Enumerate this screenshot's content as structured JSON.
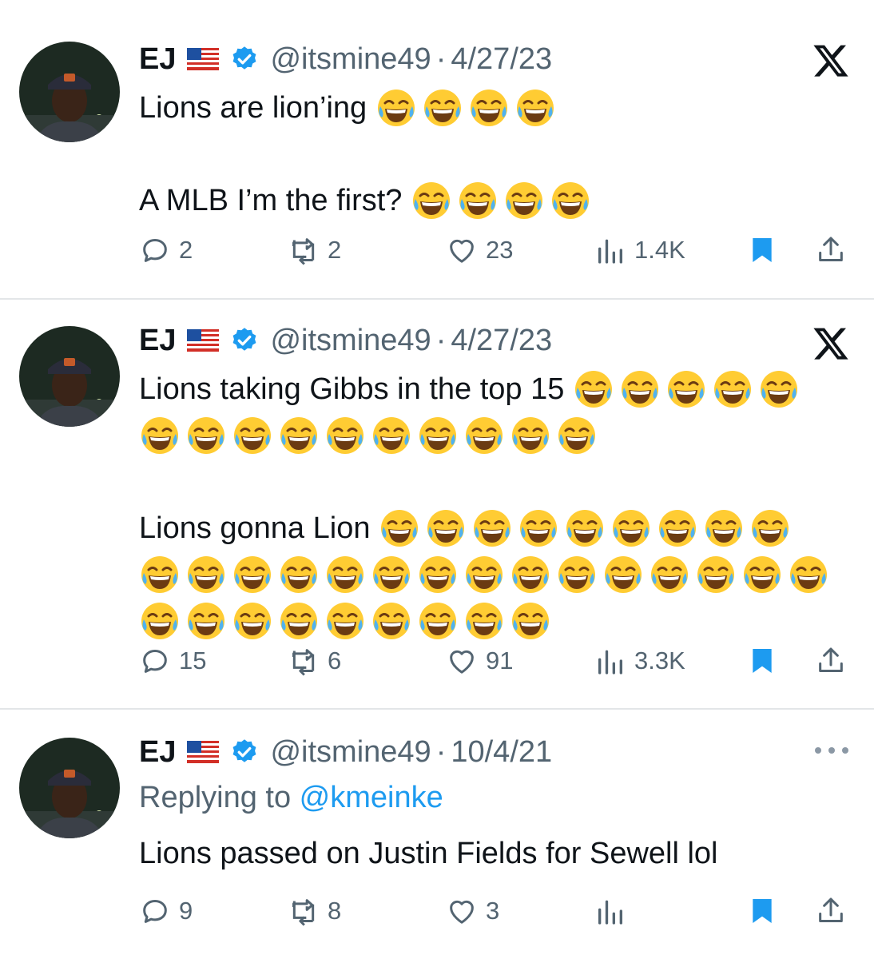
{
  "colors": {
    "accent": "#1d9bf0",
    "text": "#0f1419",
    "muted": "#536471",
    "divider": "#e3e6e8"
  },
  "tweets": [
    {
      "name": "EJ",
      "handle": "@itsmine49",
      "sep": "·",
      "date": "4/27/23",
      "corner_icon": "x-logo-icon",
      "lines": [
        {
          "text": "Lions are lion’ing ",
          "emoji": 4
        },
        {
          "text": "",
          "emoji": 0
        },
        {
          "text": "A MLB I’m the first? ",
          "emoji": 4
        }
      ],
      "replies": "2",
      "retweets": "2",
      "likes": "23",
      "views": "1.4K"
    },
    {
      "name": "EJ",
      "handle": "@itsmine49",
      "sep": "·",
      "date": "4/27/23",
      "corner_icon": "x-logo-icon",
      "lines": [
        {
          "text": "Lions taking Gibbs in the top 15 ",
          "emoji": 5
        },
        {
          "text": "",
          "emoji": 10
        },
        {
          "text": "",
          "emoji": 0
        },
        {
          "text": "Lions gonna Lion ",
          "emoji": 9
        },
        {
          "text": "",
          "emoji": 15
        },
        {
          "text": "",
          "emoji": 9
        }
      ],
      "replies": "15",
      "retweets": "6",
      "likes": "91",
      "views": "3.3K"
    },
    {
      "name": "EJ",
      "handle": "@itsmine49",
      "sep": "·",
      "date": "10/4/21",
      "corner_icon": "more-dots-icon",
      "replying_prefix": "Replying to ",
      "replying_to": "@kmeinke",
      "text": "Lions passed on Justin Fields for Sewell lol",
      "replies": "9",
      "retweets": "8",
      "likes": "3",
      "views": ""
    }
  ]
}
